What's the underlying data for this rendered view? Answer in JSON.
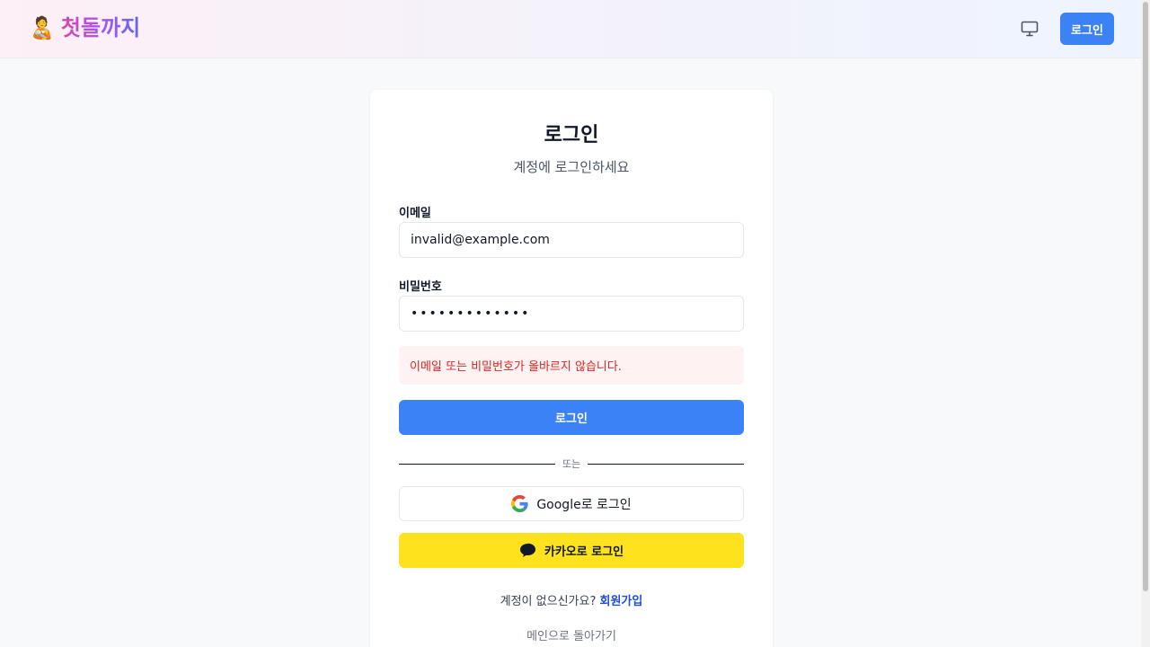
{
  "header": {
    "brand_emoji": "🧑‍🍼",
    "brand_title": "첫돌까지",
    "monitor_icon": "monitor-icon",
    "login_label": "로그인"
  },
  "card": {
    "title": "로그인",
    "subtitle": "계정에 로그인하세요"
  },
  "form": {
    "email_label": "이메일",
    "email_value": "invalid@example.com",
    "password_label": "비밀번호",
    "password_value": "•••••••••••••",
    "error_message": "이메일 또는 비밀번호가 올바르지 않습니다.",
    "submit_label": "로그인",
    "divider_text": "또는",
    "google_label": "Google로 로그인",
    "kakao_label": "카카오로 로그인"
  },
  "footer": {
    "signup_prompt": "계정이 없으신가요? ",
    "signup_link": "회원가입",
    "back_link": "메인으로 돌아가기"
  },
  "colors": {
    "accent": "#3b82f6",
    "error_text": "#dc2626",
    "error_bg": "#fef2f2",
    "kakao": "#fee21d",
    "signup_link": "#1d4ed8"
  }
}
